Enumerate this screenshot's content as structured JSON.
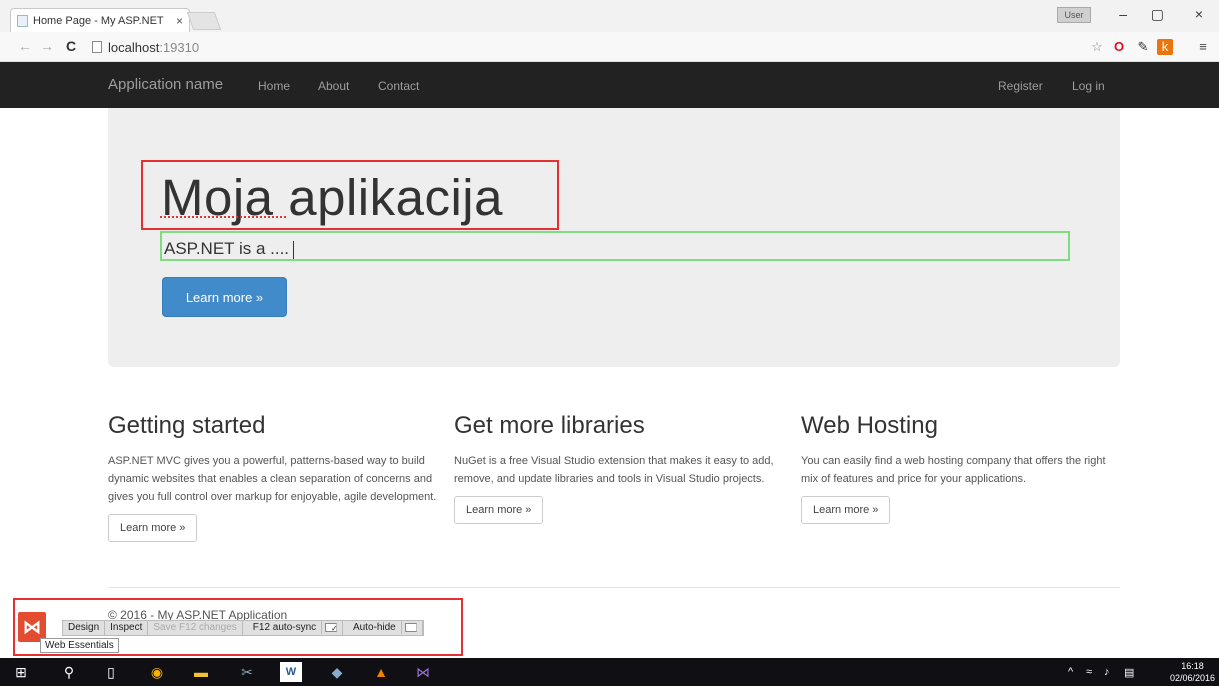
{
  "browser": {
    "tab_title": "Home Page - My ASP.NET",
    "tab_close": "×",
    "url_host": "localhost",
    "url_port": ":19310",
    "window_user": "User",
    "minimize": "–",
    "restore": "▢",
    "close": "×",
    "back": "←",
    "forward": "→",
    "reload": "C"
  },
  "navbar": {
    "brand": "Application name",
    "links": [
      "Home",
      "About",
      "Contact"
    ],
    "right_links": [
      "Register",
      "Log in"
    ]
  },
  "jumbotron": {
    "title": "Moja aplikacija",
    "lead": "ASP.NET is a ....",
    "button": "Learn more »"
  },
  "columns": [
    {
      "heading": "Getting started",
      "text": "ASP.NET MVC gives you a powerful, patterns-based way to build dynamic websites that enables a clean separation of concerns and gives you full control over markup for enjoyable, agile development.",
      "button": "Learn more »"
    },
    {
      "heading": "Get more libraries",
      "text": "NuGet is a free Visual Studio extension that makes it easy to add, remove, and update libraries and tools in Visual Studio projects.",
      "button": "Learn more »"
    },
    {
      "heading": "Web Hosting",
      "text": "You can easily find a web hosting company that offers the right mix of features and price for your applications.",
      "button": "Learn more »"
    }
  ],
  "footer": {
    "text": "© 2016 - My ASP.NET Application"
  },
  "web_essentials": {
    "design": "Design",
    "inspect": "Inspect",
    "save": "Save F12 changes",
    "autosync": "F12 auto-sync",
    "autohide": "Auto-hide",
    "tooltip": "Web Essentials",
    "autosync_checked": true,
    "autohide_checked": false
  },
  "taskbar": {
    "time": "16:18",
    "date": "02/06/2016"
  },
  "colors": {
    "navbar_bg": "#222222",
    "jumbotron_bg": "#eeeeee",
    "primary": "#428bca",
    "annotation_red": "#e53030",
    "annotation_green": "#7fdc7f"
  }
}
